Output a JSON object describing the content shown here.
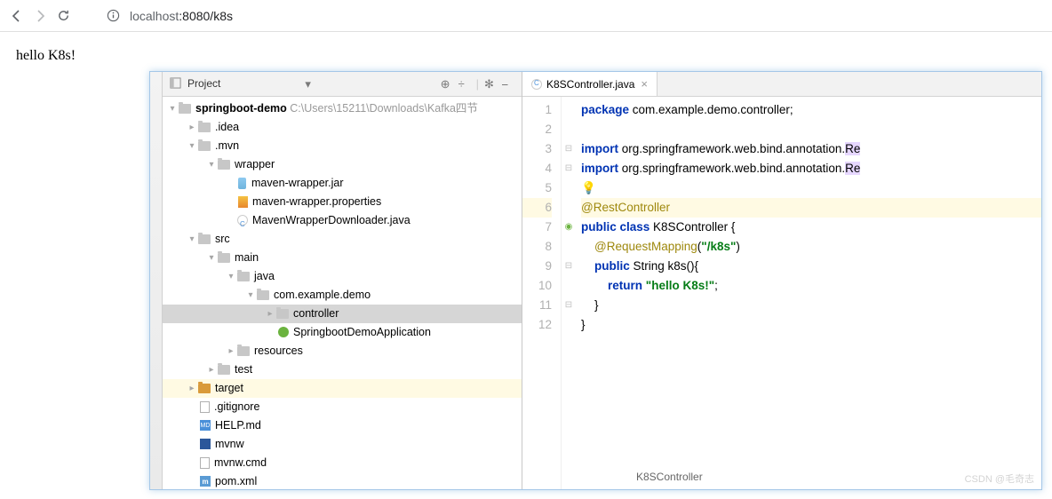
{
  "browser": {
    "url_prefix": "localhost",
    "url_port_path": ":8080/k8s"
  },
  "page": {
    "body_text": "hello K8s!"
  },
  "project_panel": {
    "title": "Project",
    "root_name": "springboot-demo",
    "root_path": "C:\\Users\\15211\\Downloads\\Kafka四节",
    "nodes": {
      "idea": ".idea",
      "mvn": ".mvn",
      "wrapper": "wrapper",
      "wrapper_jar": "maven-wrapper.jar",
      "wrapper_props": "maven-wrapper.properties",
      "wrapper_dl": "MavenWrapperDownloader.java",
      "src": "src",
      "main": "main",
      "java": "java",
      "pkg": "com.example.demo",
      "controller": "controller",
      "app": "SpringbootDemoApplication",
      "resources": "resources",
      "test": "test",
      "target": "target",
      "gitignore": ".gitignore",
      "help": "HELP.md",
      "mvnw": "mvnw",
      "mvnw_cmd": "mvnw.cmd",
      "pom": "pom.xml"
    }
  },
  "editor": {
    "tab_name": "K8SController.java",
    "breadcrumb": "K8SController",
    "lines": [
      "1",
      "2",
      "3",
      "4",
      "5",
      "6",
      "7",
      "8",
      "9",
      "10",
      "11",
      "12"
    ],
    "code": {
      "l1a": "package",
      "l1b": " com.example.demo.controller;",
      "l3a": "import",
      "l3b": " org.springframework.web.bind.annotation.",
      "l3c": "Re",
      "l4a": "import",
      "l4b": " org.springframework.web.bind.annotation.",
      "l4c": "Re",
      "l6": "@RestController",
      "l7a": "public class",
      "l7b": " K8SController {",
      "l8a": "    ",
      "l8b": "@RequestMapping",
      "l8c": "(",
      "l8d": "\"/k8s\"",
      "l8e": ")",
      "l9a": "    ",
      "l9b": "public",
      "l9c": " String k8s(){",
      "l10a": "        ",
      "l10b": "return",
      "l10c": " ",
      "l10d": "\"hello K8s!\"",
      "l10e": ";",
      "l11": "    }",
      "l12": "}"
    }
  },
  "watermark": "CSDN @毛奇志"
}
